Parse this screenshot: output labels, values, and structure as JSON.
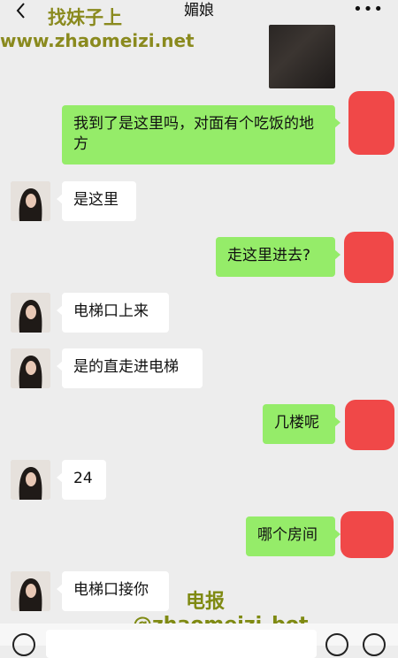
{
  "header": {
    "title": "媚娘",
    "more": "•••"
  },
  "watermark": {
    "title": "找妹子上",
    "url": "www.zhaomeizi.net",
    "telegram": "电报",
    "bot": "@zhaomeizi_bot"
  },
  "messages": [
    {
      "side": "right",
      "text": "我到了是这里吗，对面有个吃饭的地方"
    },
    {
      "side": "left",
      "text": "是这里"
    },
    {
      "side": "right",
      "text": "走这里进去?"
    },
    {
      "side": "left",
      "text": "电梯口上来"
    },
    {
      "side": "left",
      "text": "是的直走进电梯"
    },
    {
      "side": "right",
      "text": "几楼呢"
    },
    {
      "side": "left",
      "text": "24"
    },
    {
      "side": "right",
      "text": "哪个房间"
    },
    {
      "side": "left",
      "text": "电梯口接你"
    }
  ],
  "colors": {
    "background": "#ededed",
    "bubble_right": "#95ec69",
    "bubble_left": "#ffffff",
    "redaction": "#f04848",
    "watermark": "#8a8a1e"
  },
  "icons": [
    "back-icon",
    "more-icon",
    "voice-icon",
    "emoji-icon",
    "plus-icon"
  ]
}
